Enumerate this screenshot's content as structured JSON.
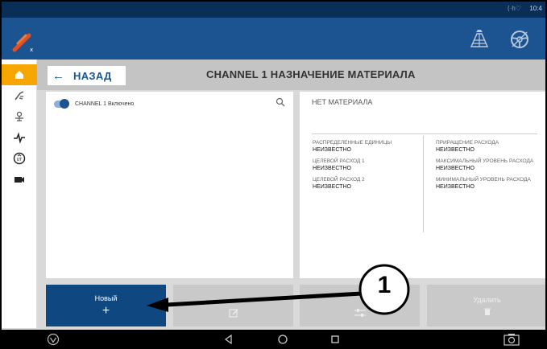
{
  "statusbar": {
    "time": "10:4"
  },
  "titlebar": {
    "back_label": "НАЗАД",
    "title": "CHANNEL 1 НАЗНАЧЕНИЕ МАТЕРИАЛА"
  },
  "left_panel": {
    "toggle_label": "CHANNEL 1 Включено",
    "toggle_on": true
  },
  "right_panel": {
    "no_material": "НЕТ МАТЕРИАЛА",
    "left_items": [
      {
        "label": "РАСПРЕДЕЛЕННЫЕ ЕДИНИЦЫ",
        "value": "НЕИЗВЕСТНО"
      },
      {
        "label": "ЦЕЛЕВОЙ РАСХОД 1",
        "value": "НЕИЗВЕСТНО"
      },
      {
        "label": "ЦЕЛЕВОЙ РАСХОД 2",
        "value": "НЕИЗВЕСТНО"
      }
    ],
    "right_items": [
      {
        "label": "ПРИРАЩЕНИЕ РАСХОДА",
        "value": "НЕИЗВЕСТНО"
      },
      {
        "label": "МАКСИМАЛЬНЫЙ УРОВЕНЬ РАСХОДА",
        "value": "НЕИЗВЕСТНО"
      },
      {
        "label": "МИНИМАЛЬНЫЙ УРОВЕНЬ РАСХОДА",
        "value": "НЕИЗВЕСТНО"
      }
    ]
  },
  "buttons": {
    "new_label": "Новый",
    "new_symbol": "+",
    "delete_label": "Удалить"
  },
  "callout": {
    "number": "1"
  },
  "colors": {
    "header": "#1b5490",
    "statusbar": "#0a2f57",
    "accent": "#f7a600",
    "primary_button": "#0f4780"
  },
  "icons": {
    "sidebar": [
      "home-icon",
      "sprayer-icon",
      "seeder-icon",
      "signal-icon",
      "ut-icon",
      "camera-icon"
    ],
    "header": [
      "logo-icon",
      "field-icon",
      "steering-wheel-icon"
    ],
    "nav": [
      "menu-icon",
      "back-icon",
      "home-icon",
      "recents-icon",
      "screenshot-icon"
    ]
  }
}
